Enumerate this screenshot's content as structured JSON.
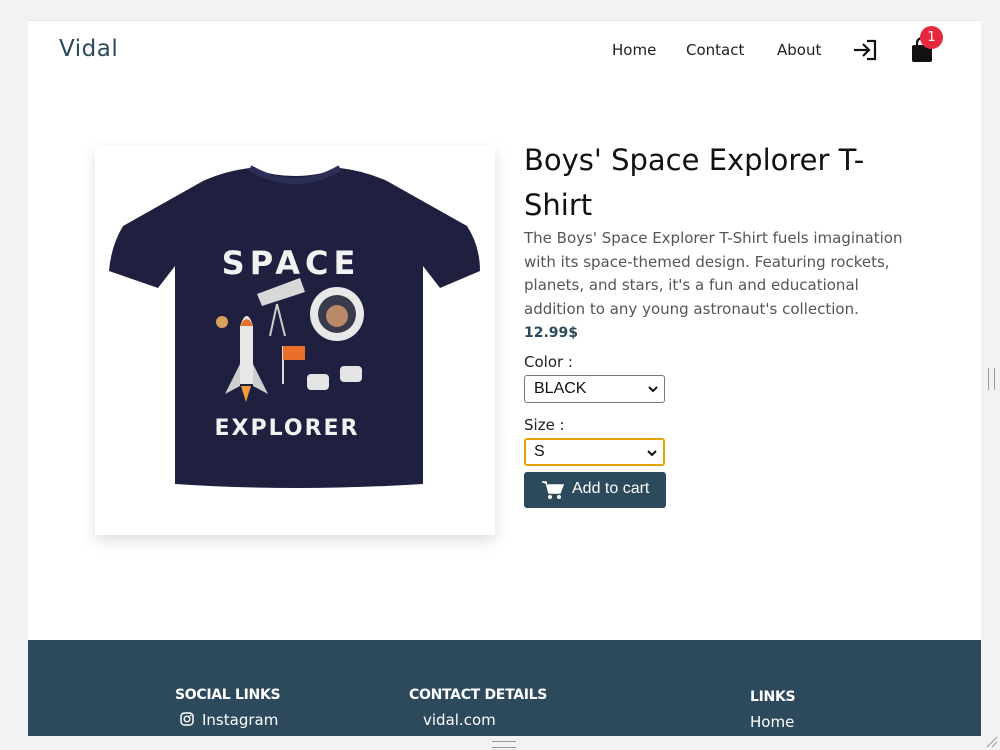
{
  "header": {
    "brand": "Vidal",
    "nav": [
      "Home",
      "Contact",
      "About"
    ],
    "cart_count": "1",
    "icons": {
      "login": "login-arrow-icon",
      "cart": "shopping-bag-icon"
    }
  },
  "product": {
    "title": "Boys' Space Explorer T-Shirt",
    "description": "The Boys' Space Explorer T-Shirt fuels imagination with its space-themed design. Featuring rockets, planets, and stars, it's a fun and educational addition to any young astronaut's collection.",
    "price": "12.99$",
    "image_text": {
      "top": "SPACE",
      "bottom": "EXPLORER"
    },
    "color_label": "Color :",
    "color_value": "BLACK",
    "size_label": "Size :",
    "size_value": "S",
    "add_to_cart": "Add to cart"
  },
  "footer": {
    "social_heading": "SOCIAL LINKS",
    "social_item": "Instagram",
    "contact_heading": "CONTACT DETAILS",
    "contact_item": "vidal.com",
    "links_heading": "LINKS",
    "links_item": "Home"
  },
  "colors": {
    "brand": "#2c4a5c",
    "badge": "#e8283d",
    "focus_outline": "#e6a200",
    "shirt": "#1f2040"
  }
}
